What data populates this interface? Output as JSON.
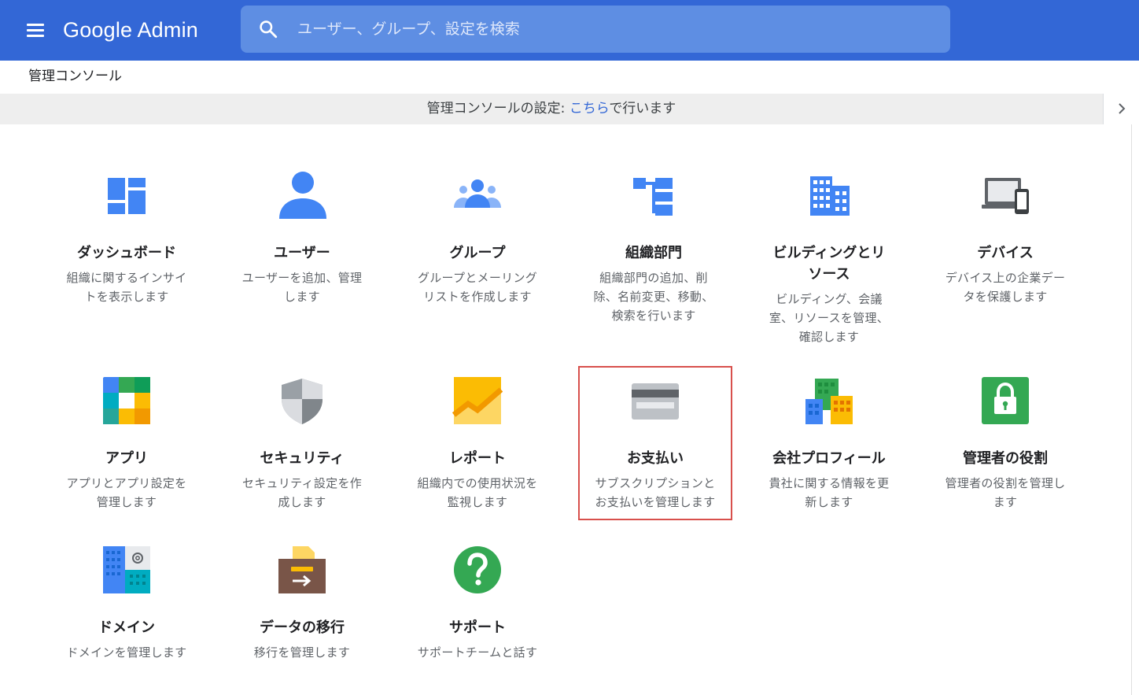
{
  "header": {
    "logo": "Google Admin",
    "search_placeholder": "ユーザー、グループ、設定を検索"
  },
  "breadcrumb": "管理コンソール",
  "notice": {
    "before": "管理コンソールの設定: ",
    "link": "こちら",
    "after": "で行います"
  },
  "colors": {
    "brand_blue": "#3367d6",
    "highlight_border": "#d8504c"
  },
  "cards": [
    {
      "title": "ダッシュボード",
      "title2": "",
      "desc": "組織に関するインサイ",
      "desc2": "トを表示します",
      "desc3": "",
      "icon": "dashboard-icon"
    },
    {
      "title": "ユーザー",
      "title2": "",
      "desc": "ユーザーを追加、管理",
      "desc2": "します",
      "desc3": "",
      "icon": "user-icon"
    },
    {
      "title": "グループ",
      "title2": "",
      "desc": "グループとメーリング",
      "desc2": "リストを作成します",
      "desc3": "",
      "icon": "group-icon"
    },
    {
      "title": "組織部門",
      "title2": "",
      "desc": "組織部門の追加、削",
      "desc2": "除、名前変更、移動、",
      "desc3": "検索を行います",
      "icon": "org-unit-icon"
    },
    {
      "title": "ビルディングとリ",
      "title2": "ソース",
      "desc": "ビルディング、会議",
      "desc2": "室、リソースを管理、",
      "desc3": "確認します",
      "icon": "building-icon"
    },
    {
      "title": "デバイス",
      "title2": "",
      "desc": "デバイス上の企業デー",
      "desc2": "タを保護します",
      "desc3": "",
      "icon": "devices-icon"
    },
    {
      "title": "アプリ",
      "title2": "",
      "desc": "アプリとアプリ設定を",
      "desc2": "管理します",
      "desc3": "",
      "icon": "apps-icon"
    },
    {
      "title": "セキュリティ",
      "title2": "",
      "desc": "セキュリティ設定を作",
      "desc2": "成します",
      "desc3": "",
      "icon": "security-shield-icon"
    },
    {
      "title": "レポート",
      "title2": "",
      "desc": "組織内での使用状況を",
      "desc2": "監視します",
      "desc3": "",
      "icon": "reports-chart-icon"
    },
    {
      "title": "お支払い",
      "title2": "",
      "desc": "サブスクリプションと",
      "desc2": "お支払いを管理します",
      "desc3": "",
      "icon": "billing-card-icon"
    },
    {
      "title": "会社プロフィール",
      "title2": "",
      "desc": "貴社に関する情報を更",
      "desc2": "新します",
      "desc3": "",
      "icon": "company-profile-icon"
    },
    {
      "title": "管理者の役割",
      "title2": "",
      "desc": "管理者の役割を管理し",
      "desc2": "ます",
      "desc3": "",
      "icon": "admin-roles-lock-icon"
    },
    {
      "title": "ドメイン",
      "title2": "",
      "desc": "ドメインを管理します",
      "desc2": "",
      "desc3": "",
      "icon": "domains-icon"
    },
    {
      "title": "データの移行",
      "title2": "",
      "desc": "移行を管理します",
      "desc2": "",
      "desc3": "",
      "icon": "data-migration-icon"
    },
    {
      "title": "サポート",
      "title2": "",
      "desc": "サポートチームと話す",
      "desc2": "",
      "desc3": "",
      "icon": "support-help-icon"
    }
  ]
}
